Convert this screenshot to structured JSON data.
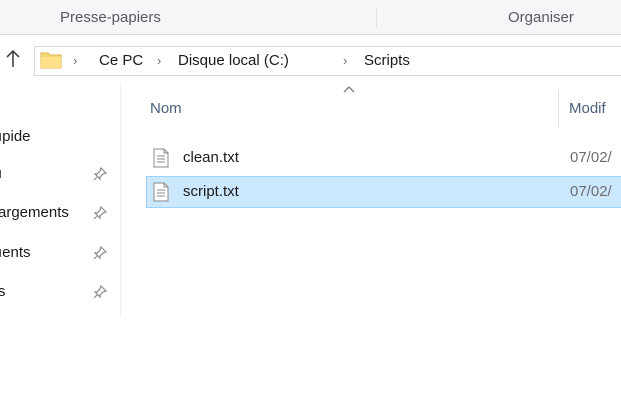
{
  "ribbon": {
    "groups": [
      "Presse-papiers",
      "Organiser"
    ]
  },
  "address_bar": {
    "up_icon": "up-arrow-icon",
    "folder_icon": "folder-icon",
    "path": [
      "Ce PC",
      "Disque local (C:)",
      "Scripts"
    ]
  },
  "nav_pane": {
    "items": [
      {
        "label": "ıpide",
        "pinned": false
      },
      {
        "label": "ı",
        "pinned": true
      },
      {
        "label": "argements",
        "pinned": true
      },
      {
        "label": "ıents",
        "pinned": true
      },
      {
        "label": "s",
        "pinned": true
      }
    ]
  },
  "file_list": {
    "columns": {
      "name": "Nom",
      "modified": "Modif"
    },
    "sort": "ascending",
    "files": [
      {
        "name": "clean.txt",
        "date": "07/02/",
        "selected": false
      },
      {
        "name": "script.txt",
        "date": "07/02/",
        "selected": true
      }
    ]
  },
  "colors": {
    "selection_bg": "#cce8ff",
    "selection_border": "#99d1ff",
    "folder": "#f8d775"
  }
}
